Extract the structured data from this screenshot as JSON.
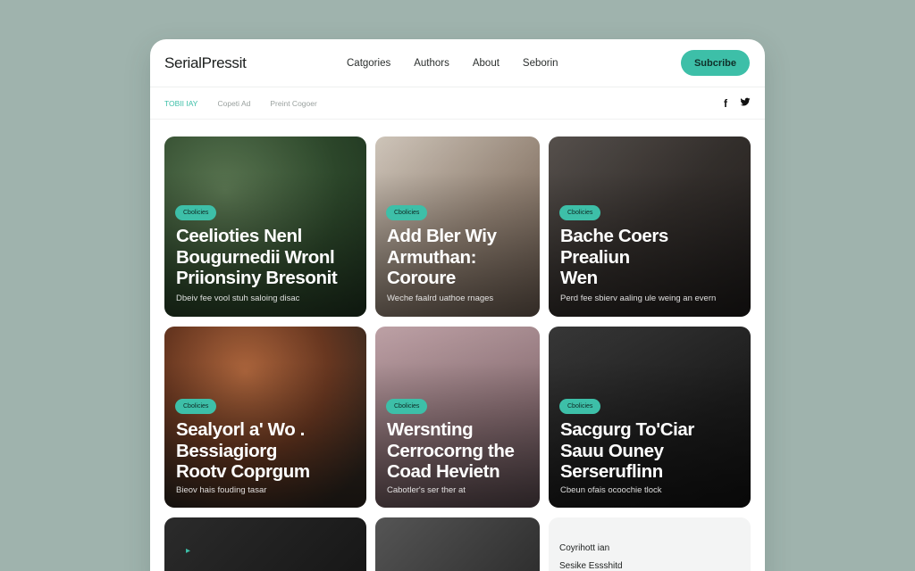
{
  "header": {
    "logo": "SerialPressit",
    "nav": [
      "Catgories",
      "Authors",
      "About",
      "Seborin"
    ],
    "subscribe_label": "Subcribe"
  },
  "subbar": {
    "tabs": [
      "TOBII IAY",
      "Copeti Ad",
      "Preint Cogoer"
    ],
    "social": [
      "facebook-icon",
      "twitter-icon"
    ]
  },
  "colors": {
    "accent": "#3dbfa8",
    "background": "#9fb3ad"
  },
  "cards": [
    {
      "badge": "Cbolicies",
      "title": "Ceelioties Nenl\nBougurnedii Wronl\nPriionsiny Bresonit",
      "excerpt": "Dbeiv fee vool stuh saloing disac"
    },
    {
      "badge": "Cbolicies",
      "title": "Add Bler Wiy\nArmuthan:\nCoroure",
      "excerpt": "Weche faalrd uathoe rnages"
    },
    {
      "badge": "Cbolicies",
      "title": "Bache Coers\nPrealiun\nWen",
      "excerpt": "Perd fee sbierv aaling ule weing an evern"
    },
    {
      "badge": "Cbolicies",
      "title": "Sealyorl a' Wo .\nBessiagiorg\nRootv Coprgum",
      "excerpt": "Bieov hais fouding tasar"
    },
    {
      "badge": "Cbolicies",
      "title": "Wersnting\nCerrocorng the\nCoad Hevietn",
      "excerpt": "Cabotler's ser ther at"
    },
    {
      "badge": "Cbolicies",
      "title": "Sacgurg To'Ciar\nSauu Ouney\nSerseruflinn",
      "excerpt": "Cbeun ofais ocoochie tlock"
    }
  ],
  "bottom": {
    "line1": "Coyrihott ian",
    "line2": "Sesike Essshitd"
  }
}
